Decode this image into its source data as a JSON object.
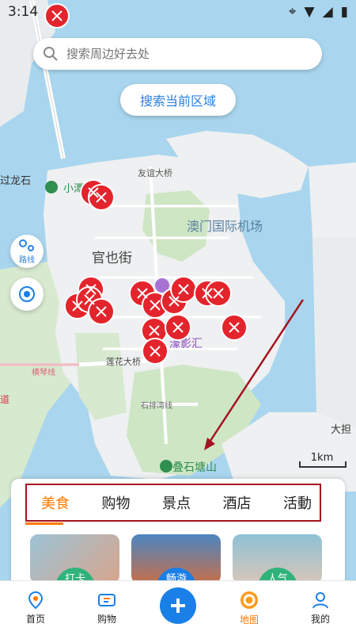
{
  "status_bar": {
    "time": "3:14"
  },
  "search": {
    "placeholder": "搜索周边好去处"
  },
  "search_area_button": "搜索当前区域",
  "route_button_label": "路线",
  "map_labels": {
    "airport": "澳门国际机场",
    "district": "官也街",
    "friendship_bridge": "友谊大桥",
    "lotus_bridge": "莲花大桥",
    "guolongshi": "过龙石",
    "xiaotan": "小潭",
    "cinema": "濠影汇",
    "shipai_bay": "石排湾线",
    "hengqin_line": "横琴线",
    "dieshitangshan": "叠石塘山",
    "dadan": "大担",
    "edge_text": "道"
  },
  "scale_label": "1km",
  "category_tabs": [
    "美食",
    "购物",
    "景点",
    "酒店",
    "活動"
  ],
  "active_tab": "美食",
  "cards": [
    {
      "badge": "打卡",
      "color": "#8ab5c9"
    },
    {
      "badge": "畅游",
      "color": "#3d6e97"
    },
    {
      "badge": "人气",
      "color": "#7ea9b7"
    }
  ],
  "bottom_nav": [
    {
      "label": "首页",
      "icon": "location-pin-icon"
    },
    {
      "label": "购物",
      "icon": "ticket-icon"
    },
    {
      "label": "",
      "icon": "plus-icon"
    },
    {
      "label": "地图",
      "icon": "map-icon"
    },
    {
      "label": "我的",
      "icon": "user-icon"
    }
  ],
  "colors": {
    "accent": "#ff7a00",
    "primary_blue": "#1a7fe6",
    "marker_red": "#e4242c",
    "annotation_red": "#a3131f"
  }
}
